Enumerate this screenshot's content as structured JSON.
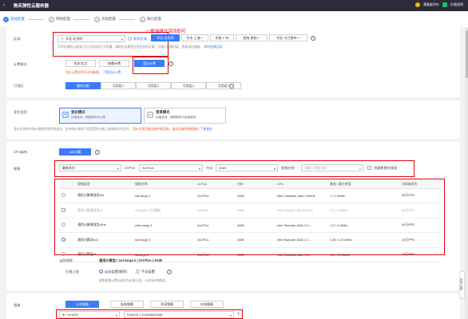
{
  "header": {
    "title": "购买弹性云服务器",
    "notice": "满意度评价",
    "account": "价格说明"
  },
  "steps": [
    {
      "num": "1",
      "label": "基础配置"
    },
    {
      "num": "2",
      "label": "网络配置"
    },
    {
      "num": "3",
      "label": "高级配置"
    },
    {
      "num": "4",
      "label": "确认配置"
    }
  ],
  "annotation": "一般选择北京四即可",
  "region": {
    "label": "区域",
    "value": "华北-北京四",
    "options": [
      "推荐区域",
      "华北-北京四",
      "华东-上海一",
      "华南-广州",
      "西南-贵阳一",
      "华北-乌兰察布一"
    ],
    "note_prefix": "不同区域的云服务产品之间内网互不相通；请就近选择靠近您业务的区域，可减少网络时延、提高访问速度。",
    "note_link": "如何选择区域"
  },
  "billing": {
    "label": "计费模式",
    "options": [
      "包年/包月",
      "按需计费",
      "竞价计费"
    ],
    "note_prefix": "竞价计费实例不支持备案。",
    "note_link": "了解竞价计费"
  },
  "az": {
    "label": "可用区",
    "options": [
      "随机分配",
      "可用区1",
      "可用区2",
      "可用区3",
      "可用区7"
    ]
  },
  "bid": {
    "label": "竞价类型",
    "cards": [
      {
        "title": "竞价模式",
        "desc": "价格波动，按使用时长计费"
      },
      {
        "title": "竞享模式",
        "desc": "价格波动，保障期间不会被释放"
      }
    ],
    "note_prefix": "竞价实例的市场价格随供需关系变化，当市场价格高于您设置的价格上限或库存不足时，",
    "note_warn": "竞价实例可能会被中断回收，请务必做好数据备份",
    "note_link": "了解更多"
  },
  "cpu_arch": {
    "label": "CPU架构",
    "value": "x86计算"
  },
  "spec": {
    "label": "规格",
    "filters": {
      "series": "最新系列",
      "vcpus_label": "vCPUs",
      "vcpus": "2vCPUs",
      "mem_label": "内存",
      "mem": "4GiB",
      "name_label": "规格名称",
      "name_placeholder": "请输入规格名称",
      "hide_soldout": "隐藏售罄的规格"
    },
    "columns": [
      "",
      "规格类型",
      "规格名称",
      "vCPUs",
      "内存",
      "CPU",
      "基准 / 最大带宽",
      "内网收发包"
    ],
    "rows": [
      {
        "type": "通用计算增强型c6s",
        "name": "c6s.large.2",
        "vcpus": "2vCPUs",
        "mem": "4GiB",
        "cpu": "Intel Cascade Lake 2.6GHz",
        "bw": "1 / 1 Gbit/s",
        "pps": "30万PPS",
        "state": "normal"
      },
      {
        "type": "通用计算增强型c3",
        "name": "c3.large.2 (已售罄)",
        "vcpus": "2vCPUs",
        "mem": "4GiB",
        "cpu": "Intel Cooper Lake 3.0GHz",
        "bw": "1.2 / 4 Gbit/s",
        "pps": "40万PPS",
        "state": "soldout"
      },
      {
        "type": "通用计算增强型c3ne",
        "name": "c3ne.large.2",
        "vcpus": "2vCPUs",
        "mem": "4GiB",
        "cpu": "Intel SkyLake 6161 3.0...",
        "bw": "1.3 / 4 Gbit/s",
        "pps": "40万PPS",
        "state": "normal"
      },
      {
        "type": "通用计算型sn3",
        "name": "sn3.large.2",
        "vcpus": "2vCPUs",
        "mem": "4GiB",
        "cpu": "Intel SkyLake 6161 2.2...",
        "bw": "0.35 / 1.5 Gbit/s",
        "pps": "15万PPS",
        "state": "selected"
      },
      {
        "type": "通用计算型s6",
        "name": "s6.large.2",
        "vcpus": "2vCPUs",
        "mem": "4GiB",
        "cpu": "Intel Cascade Lake 2.6...",
        "bw": "0.2 / 1.5 Gbit/s",
        "pps": "15万PPS",
        "state": "normal"
      }
    ],
    "current_label": "当前规格",
    "current_value": "通用计算型 | sn3.large.2 | 2vCPUs | 4GiB",
    "price_cap_label": "价格上限",
    "price_cap_options": [
      "自动设置(推荐)",
      "手动设置"
    ],
    "price_cap_note": "按照按需计费价格作为价格上限，以市场价格购买。"
  },
  "image": {
    "label": "镜像",
    "tabs": [
      "公共镜像",
      "私有镜像",
      "共享镜像",
      "市场镜像"
    ],
    "os": "CentOS",
    "version": "CentOS 7.9 64bit(40GiB)"
  },
  "feedback": "咨询·反馈"
}
